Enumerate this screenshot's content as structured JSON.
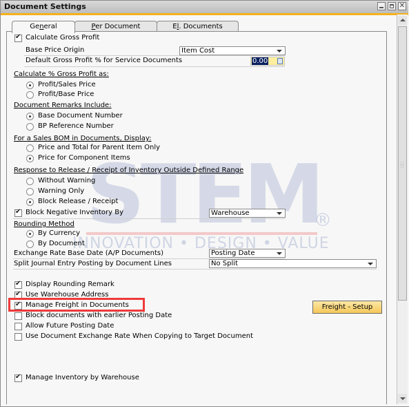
{
  "window": {
    "title": "Document Settings",
    "minimize_icon": "minimize-icon",
    "maximize_icon": "maximize-icon",
    "close_icon": "close-icon",
    "close_glyph": "✕"
  },
  "tabs": [
    {
      "label_pre": "Ge",
      "label_u": "n",
      "label_post": "eral",
      "active": true
    },
    {
      "label_pre": "",
      "label_u": "P",
      "label_post": "er Document",
      "active": false
    },
    {
      "label_pre": "E",
      "label_u": "l",
      "label_post": ". Documents",
      "active": false
    }
  ],
  "general": {
    "calc_gross_profit": {
      "label": "Calculate Gross Profit",
      "checked": true
    },
    "base_price_origin": {
      "label": "Base Price Origin",
      "value": "Item Cost"
    },
    "default_gp_service": {
      "label": "Default Gross Profit % for Service Documents",
      "value": "0.00"
    },
    "calc_pct_gp": {
      "header": "Calculate % Gross Profit as:",
      "options": [
        {
          "label": "Profit/Sales Price",
          "selected": true
        },
        {
          "label": "Profit/Base Price",
          "selected": false
        }
      ]
    },
    "doc_remarks": {
      "header": "Document Remarks Include:",
      "options": [
        {
          "label": "Base Document Number",
          "selected": true
        },
        {
          "label": "BP Reference Number",
          "selected": false
        }
      ]
    },
    "sales_bom": {
      "header": "For a Sales BOM in Documents, Display:",
      "options": [
        {
          "label": "Price and Total for Parent Item Only",
          "selected": false
        },
        {
          "label": "Price for Component Items",
          "selected": true
        }
      ]
    },
    "release_response": {
      "header": "Response to Release / Receipt of Inventory Outside Defined Range",
      "options": [
        {
          "label": "Without Warning",
          "selected": false
        },
        {
          "label": "Warning Only",
          "selected": false
        },
        {
          "label": "Block Release / Receipt",
          "selected": true
        }
      ]
    },
    "block_negative": {
      "label": "Block Negative Inventory By",
      "checked": true,
      "value": "Warehouse"
    },
    "rounding": {
      "header": "Rounding Method",
      "options": [
        {
          "label": "By Currency",
          "selected": true
        },
        {
          "label": "By Document",
          "selected": false
        }
      ]
    },
    "exchange_rate_date": {
      "label": "Exchange Rate Base Date (A/P Documents)",
      "value": "Posting Date"
    },
    "split_journal": {
      "label": "Split Journal Entry Posting by Document Lines",
      "value": "No Split"
    },
    "checkboxes": [
      {
        "label": "Display Rounding Remark",
        "checked": true
      },
      {
        "label": "Use Warehouse Address",
        "checked": true
      },
      {
        "label": "Manage Freight in Documents",
        "checked": true
      },
      {
        "label": "Block documents with earlier Posting Date",
        "checked": false
      },
      {
        "label": "Allow Future Posting Date",
        "checked": false
      },
      {
        "label": "Use Document Exchange Rate When Copying to Target Document",
        "checked": false
      }
    ],
    "freight_setup_button": "Freight - Setup",
    "manage_inventory_by_whs": {
      "label": "Manage Inventory by Warehouse",
      "checked": true
    }
  },
  "watermark": {
    "text": "STEM",
    "registered": "®",
    "tagline": "INNOVATION • DESIGN • VALUE",
    "bar_color": "#f0aaaa"
  },
  "colors": {
    "title_accent": "#f5b11a",
    "highlight_border": "#ef3a3a",
    "button_gradient_top": "#fbe7a5",
    "button_gradient_bottom": "#f5c85a",
    "field_bg": "#fdef9e",
    "selected_text_bg": "#0b2160"
  }
}
